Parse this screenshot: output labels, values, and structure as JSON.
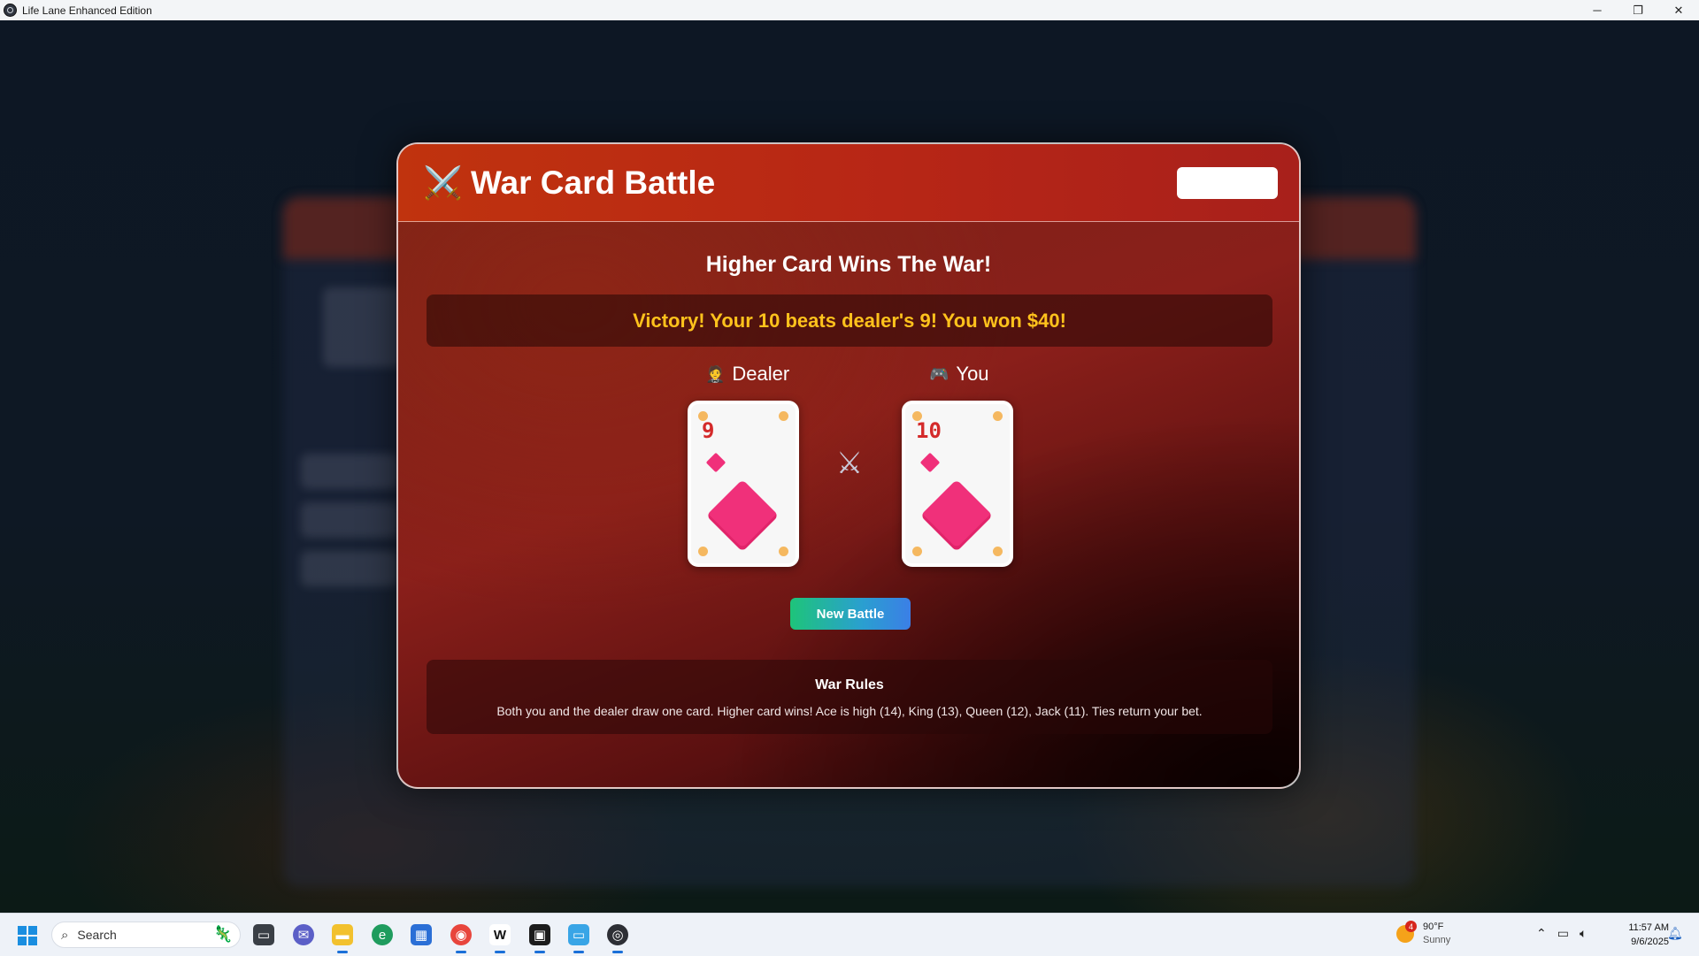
{
  "window": {
    "title": "Life Lane Enhanced Edition",
    "minimize_glyph": "─",
    "restore_glyph": "❐",
    "close_glyph": "✕"
  },
  "modal": {
    "icon": "⚔️",
    "title": "War Card Battle",
    "subtitle": "Higher Card Wins The War!",
    "result": "Victory! Your 10 beats dealer's 9! You won $40!",
    "dealer": {
      "icon": "🤵",
      "label": "Dealer",
      "card_rank": "9",
      "card_suit": "diamond"
    },
    "player": {
      "icon": "🎮",
      "label": "You",
      "card_rank": "10",
      "card_suit": "diamond"
    },
    "vs_icon": "⚔",
    "new_battle_label": "New Battle",
    "rules": {
      "title": "War Rules",
      "text": "Both you and the dealer draw one card. Higher card wins! Ace is high (14), King (13), Queen (12), Jack (11). Ties return your bet."
    }
  },
  "taskbar": {
    "search_placeholder": "Search",
    "weather": {
      "temp": "90°F",
      "condition": "Sunny",
      "badge": "4"
    },
    "clock": {
      "time": "11:57 AM",
      "date": "9/6/2025"
    }
  },
  "colors": {
    "result_text": "#ffc21c",
    "card_rank": "#d42a2a",
    "suit": "#f0307a",
    "button_gradient_start": "#1ec47a",
    "button_gradient_end": "#3b7fe6"
  }
}
